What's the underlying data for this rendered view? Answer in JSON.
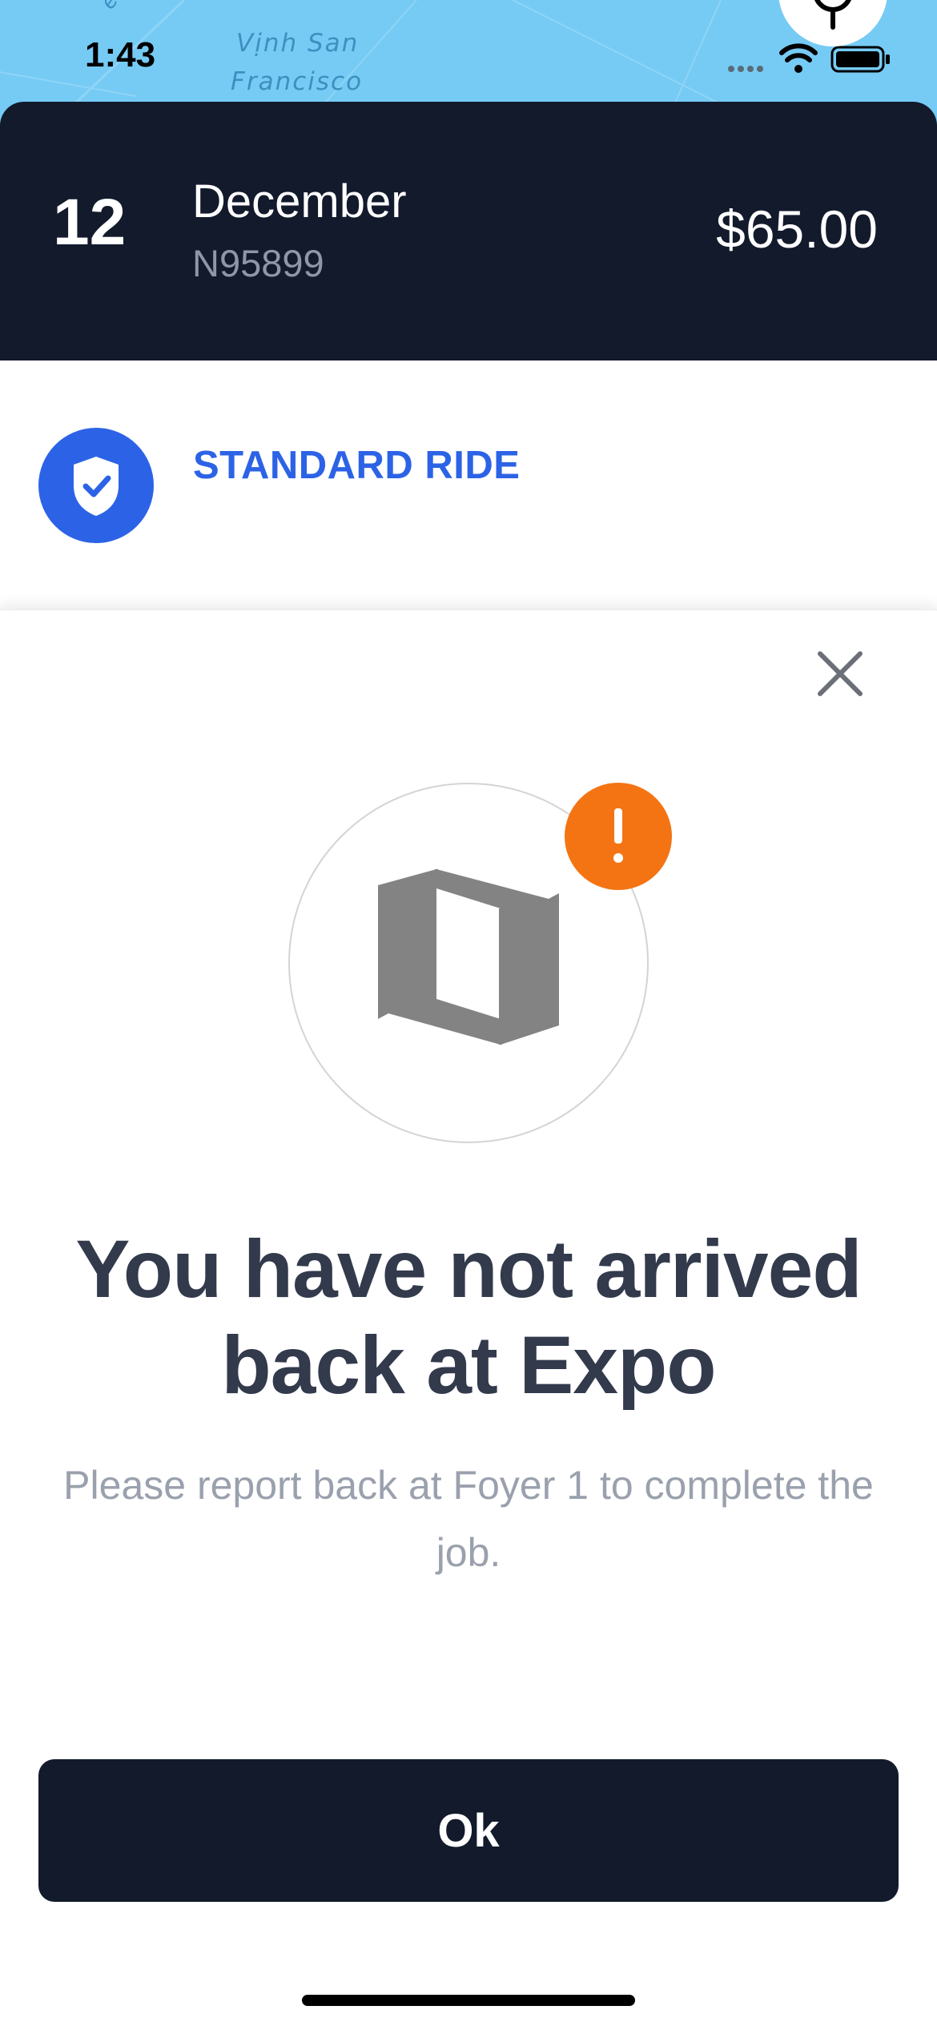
{
  "status_bar": {
    "time": "1:43"
  },
  "map": {
    "label_line1": "Vịnh San",
    "label_line2": "Francisco",
    "fragment": "erry"
  },
  "job": {
    "day": "12",
    "month": "December",
    "code": "N95899",
    "price": "$65.00"
  },
  "ride": {
    "type_label": "STANDARD RIDE",
    "badge_icon": "shield-check-icon",
    "badge_color": "#2c63e6"
  },
  "modal": {
    "illustration_icon": "map-icon",
    "alert_icon": "exclamation-icon",
    "alert_color": "#f47413",
    "title": "You have not arrived back at Expo",
    "message": "Please report back at Foyer 1 to complete the job.",
    "ok_label": "Ok",
    "close_icon": "close-icon"
  },
  "colors": {
    "dark_navy": "#121a2c",
    "accent_blue": "#2c63e6",
    "alert_orange": "#f47413",
    "map_blue": "#76cbf4"
  }
}
